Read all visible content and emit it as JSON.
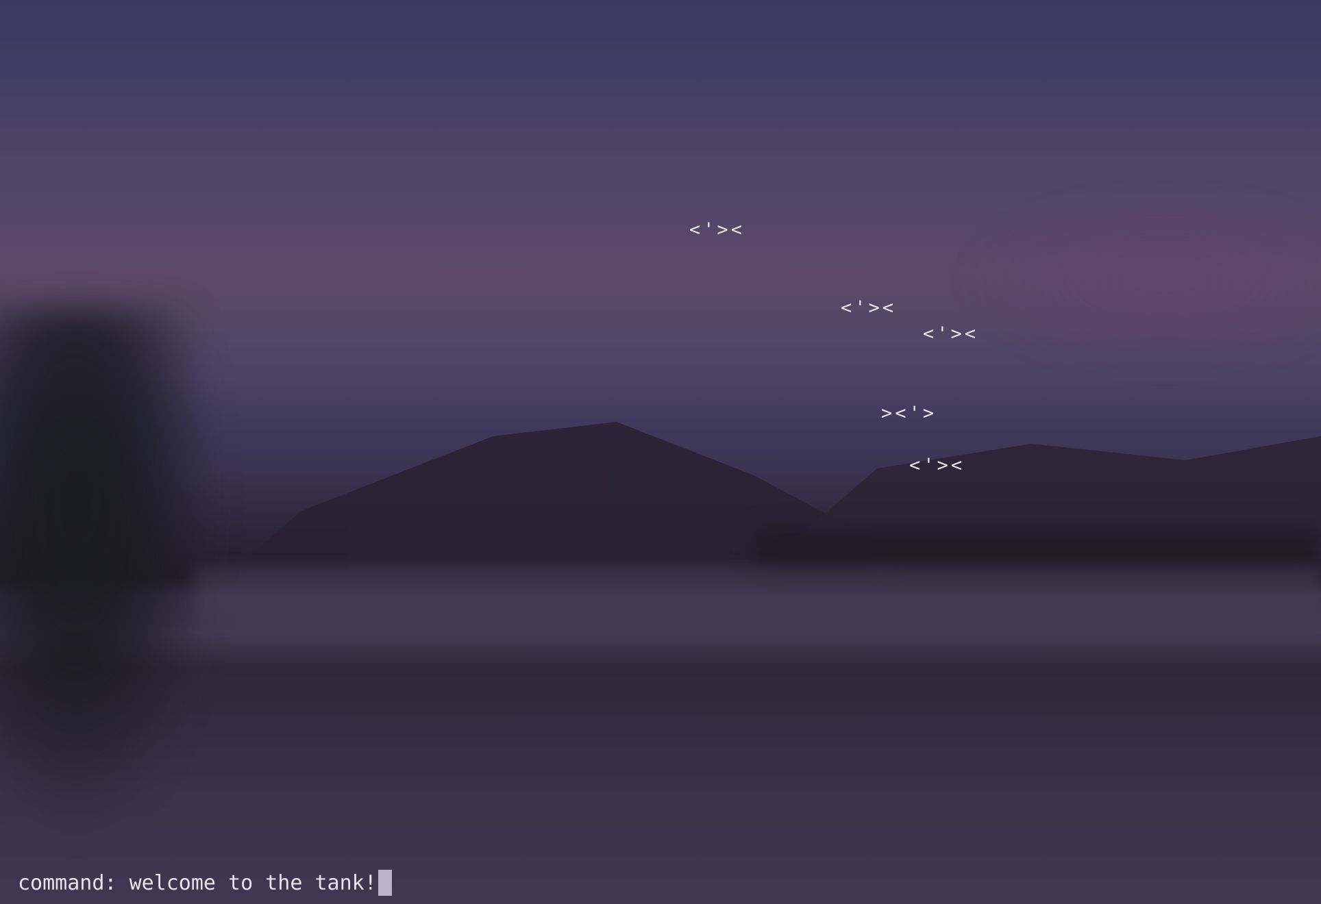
{
  "tank": {
    "fish": [
      {
        "glyph": "<'><"
      },
      {
        "glyph": "<'><"
      },
      {
        "glyph": "<'><"
      },
      {
        "glyph": "><'>"
      },
      {
        "glyph": "<'><"
      }
    ]
  },
  "command_bar": {
    "prompt": "command:",
    "message": "welcome to the tank!"
  },
  "colors": {
    "text": "#e8e4ee",
    "cursor": "#bcb3cc",
    "background": "#3b3450"
  }
}
